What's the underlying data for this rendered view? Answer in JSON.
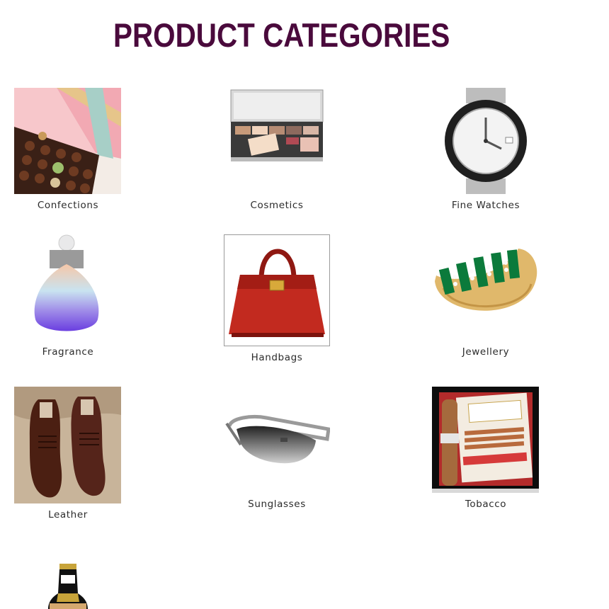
{
  "page": {
    "title": "PRODUCT CATEGORIES",
    "title_color": "#4a0a3c"
  },
  "categories": [
    {
      "label": "Confections",
      "image": "chocolate-box-image"
    },
    {
      "label": "Cosmetics",
      "image": "makeup-palette-image"
    },
    {
      "label": "Fine Watches",
      "image": "wristwatch-image"
    },
    {
      "label": "Fragrance",
      "image": "perfume-bottle-image"
    },
    {
      "label": "Handbags",
      "image": "red-handbag-image"
    },
    {
      "label": "Jewellery",
      "image": "gem-ring-image"
    },
    {
      "label": "Leather",
      "image": "leather-shoes-image"
    },
    {
      "label": "Sunglasses",
      "image": "sunglasses-image"
    },
    {
      "label": "Tobacco",
      "image": "cigar-box-image"
    },
    {
      "image": "champagne-bottle-image"
    }
  ]
}
